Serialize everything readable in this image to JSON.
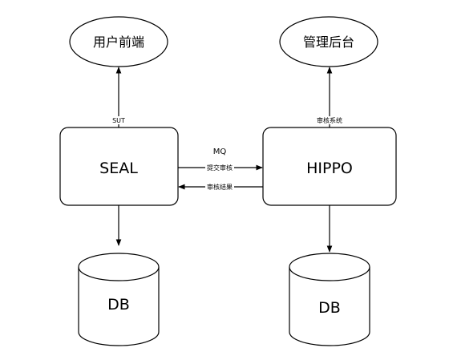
{
  "nodes": {
    "frontend": "用户前端",
    "admin": "管理后台",
    "seal": "SEAL",
    "hippo": "HIPPO",
    "db_left": "DB",
    "db_right": "DB"
  },
  "edges": {
    "seal_to_frontend": "SUT",
    "hippo_to_admin": "审核系统",
    "mq": "MQ",
    "submit_review": "提交审核",
    "review_result": "审核结果"
  },
  "colors": {
    "stroke": "#000000",
    "fill": "#ffffff"
  }
}
